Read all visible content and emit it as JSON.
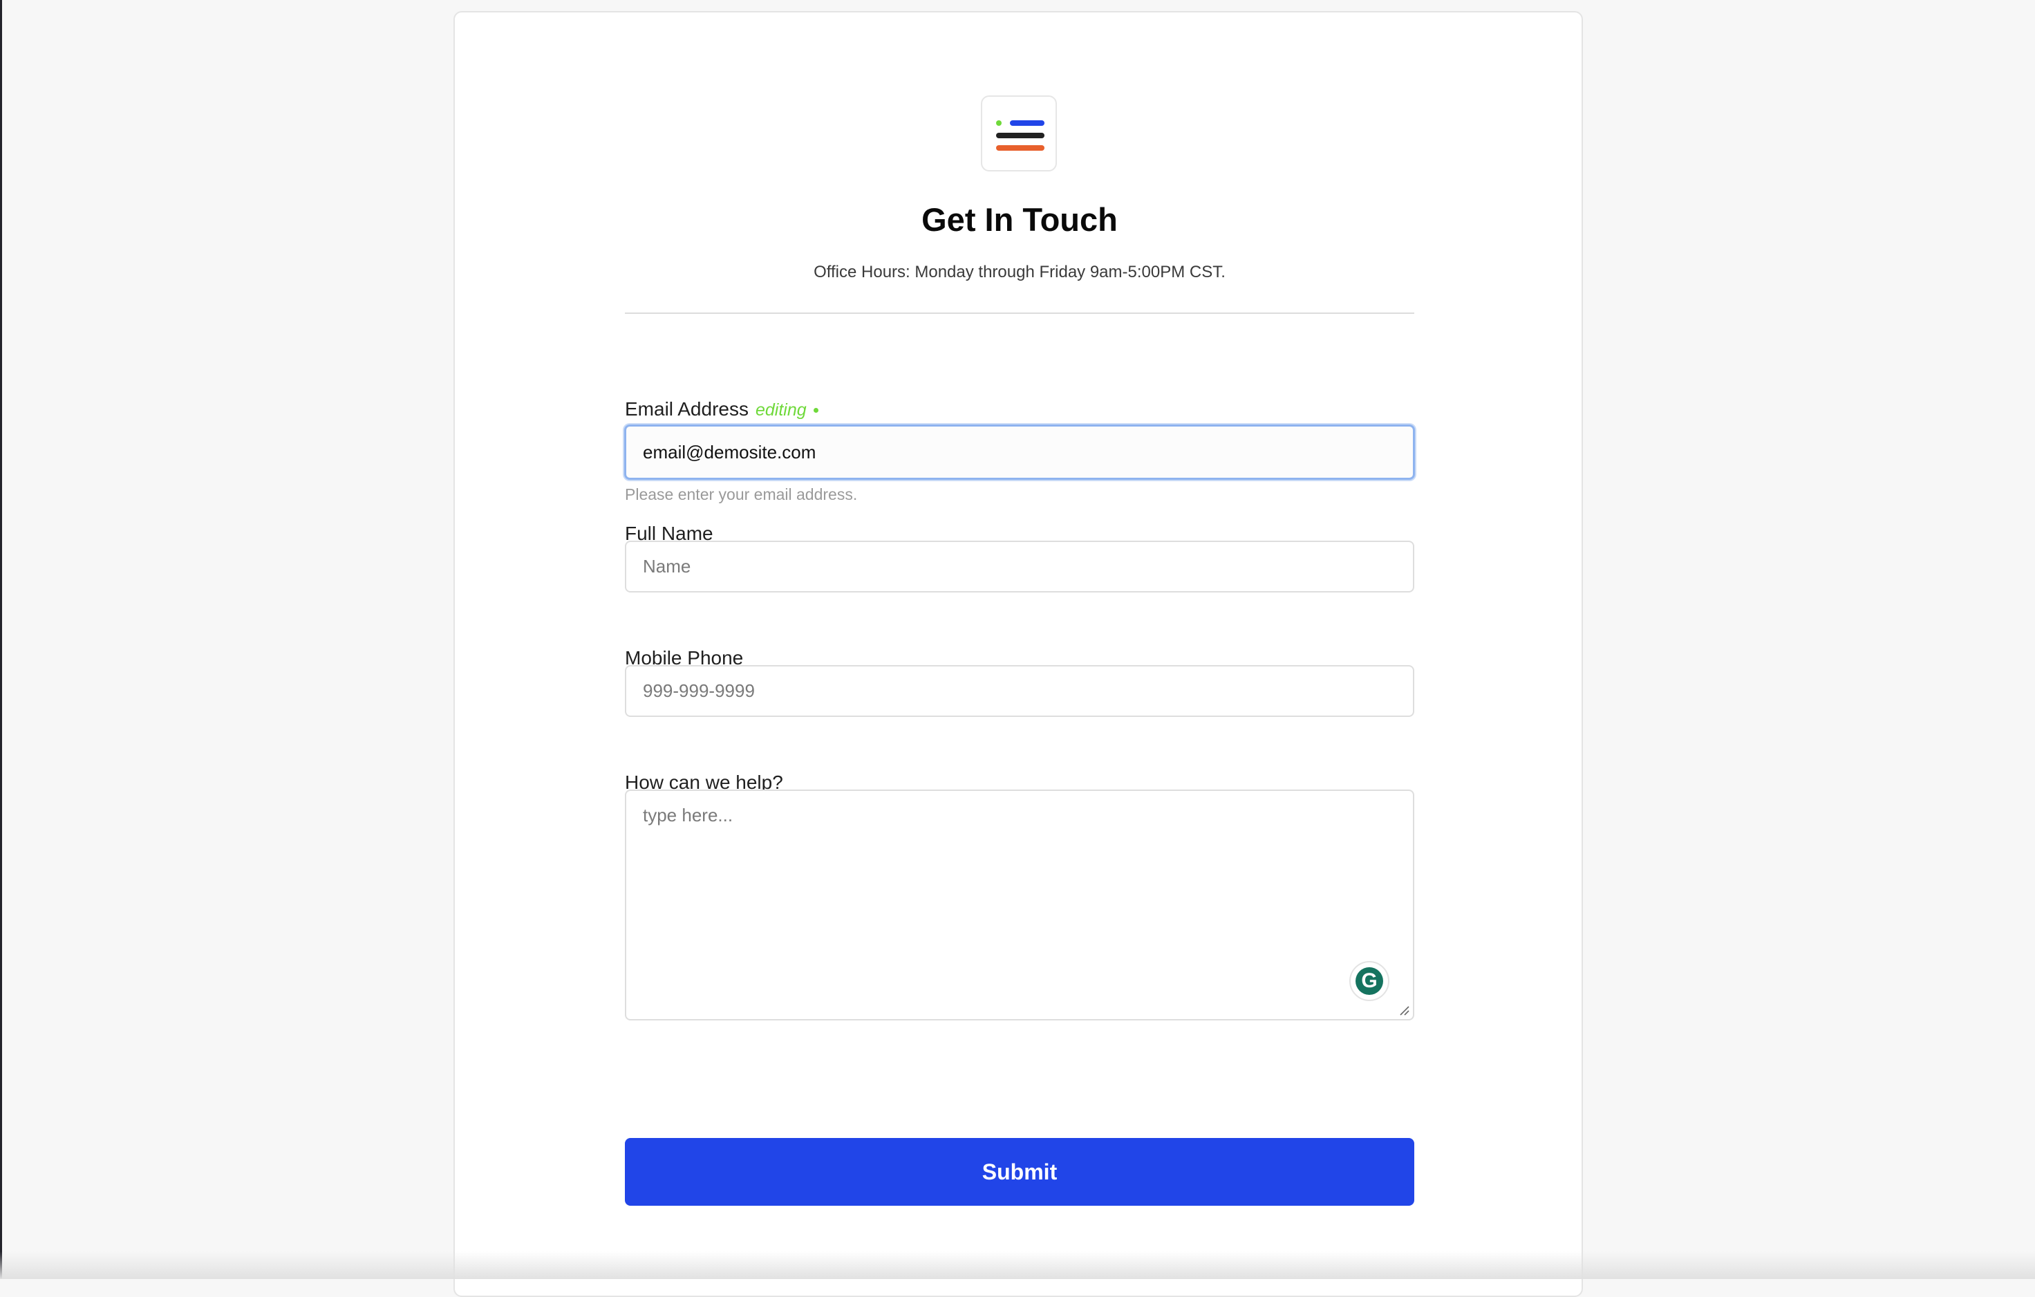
{
  "header": {
    "title": "Get In Touch",
    "subtitle": "Office Hours: Monday through Friday 9am-5:00PM CST."
  },
  "logo": {
    "icon": "menu-lines-logo-icon",
    "colors": [
      "#6fd93a",
      "#2145e8",
      "#222222",
      "#e8602c"
    ]
  },
  "form": {
    "email": {
      "label": "Email Address",
      "status": "editing",
      "value": "email@demosite.com",
      "hint": "Please enter your email address."
    },
    "full_name": {
      "label": "Full Name",
      "placeholder": "Name"
    },
    "mobile_phone": {
      "label": "Mobile Phone",
      "placeholder": "999-999-9999"
    },
    "message": {
      "label": "How can we help?",
      "placeholder": "type here..."
    },
    "submit_label": "Submit"
  },
  "widgets": {
    "grammarly_icon": "grammarly-icon",
    "grammarly_letter": "G"
  },
  "colors": {
    "accent": "#2145e8",
    "editing": "#6fd93a",
    "focus_border": "#8eb3ef"
  }
}
